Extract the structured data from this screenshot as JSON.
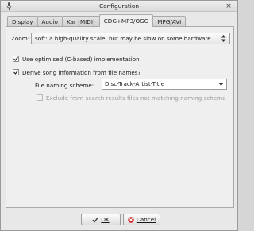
{
  "window": {
    "title": "Configuration",
    "close_glyph": "×"
  },
  "tabs": [
    {
      "label": "Display",
      "active": false
    },
    {
      "label": "Audio",
      "active": false
    },
    {
      "label": "Kar (MIDI)",
      "active": false
    },
    {
      "label": "CDG+MP3/OGG",
      "active": true
    },
    {
      "label": "MPG/AVI",
      "active": false
    }
  ],
  "zoom": {
    "label": "Zoom:",
    "value": "soft: a high-quality scale, but may be slow on some hardware",
    "icon": "spin-updown-icon"
  },
  "options": {
    "optimised": {
      "label": "Use optimised (C-based) implementation",
      "checked": true
    },
    "derive": {
      "label": "Derive song information from file names?",
      "checked": true
    },
    "naming_scheme": {
      "label": "File naming scheme:",
      "value": "Disc-Track-Artist-Title",
      "icon": "chevron-down-icon"
    },
    "exclude": {
      "label": "Exclude from search results files not matching naming scheme",
      "checked": false,
      "enabled": false
    }
  },
  "buttons": {
    "ok": {
      "label": "OK",
      "icon": "check-icon"
    },
    "cancel": {
      "label": "Cancel",
      "icon": "cancel-icon",
      "icon_color": "#d32020"
    }
  }
}
